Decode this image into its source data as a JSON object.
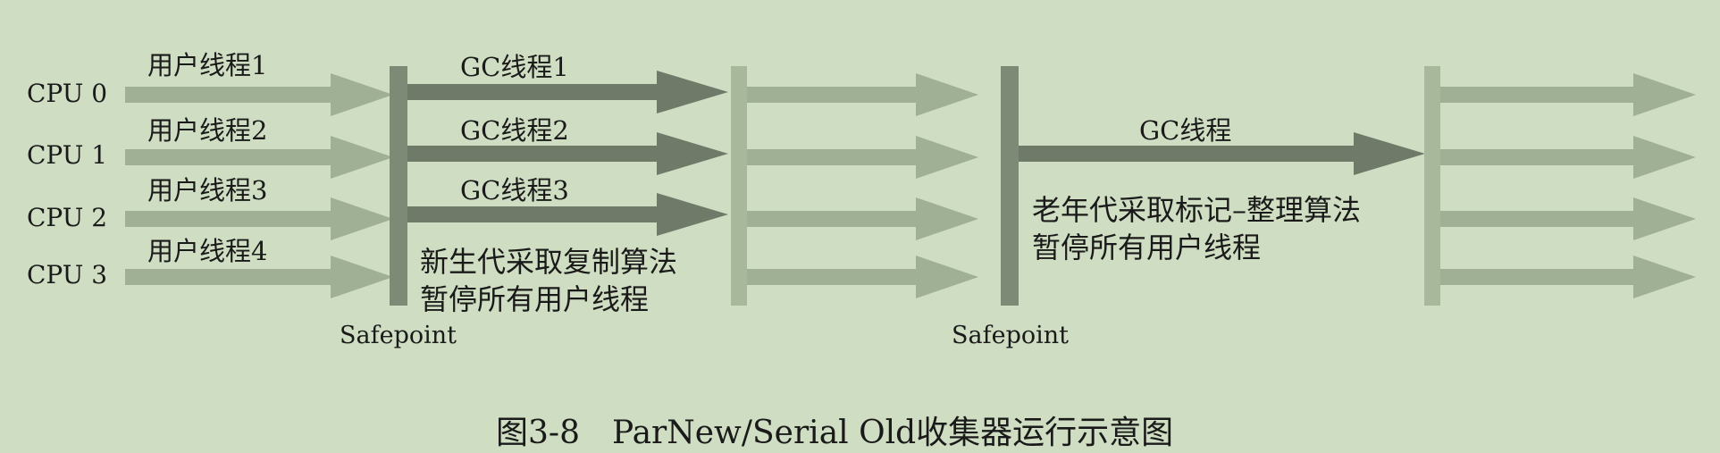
{
  "cpus": [
    "CPU 0",
    "CPU 1",
    "CPU 2",
    "CPU 3"
  ],
  "user_threads": [
    "用户线程1",
    "用户线程2",
    "用户线程3",
    "用户线程4"
  ],
  "gc_threads_young": [
    "GC线程1",
    "GC线程2",
    "GC线程3"
  ],
  "young_phase": {
    "line1": "新生代采取复制算法",
    "line2": "暂停所有用户线程"
  },
  "gc_thread_old": "GC线程",
  "old_phase": {
    "line1": "老年代采取标记–整理算法",
    "line2": "暂停所有用户线程"
  },
  "safepoints": [
    "Safepoint",
    "Safepoint"
  ],
  "caption": "图3-8　ParNew/Serial Old收集器运行示意图",
  "colors": {
    "background": "#cfddc2",
    "user_thread_arrow": "#9fb095",
    "gc_thread_arrow": "#6f7a69",
    "safepoint_bar": "#7d8a76",
    "phase_boundary_bar": "#a7b89b"
  }
}
